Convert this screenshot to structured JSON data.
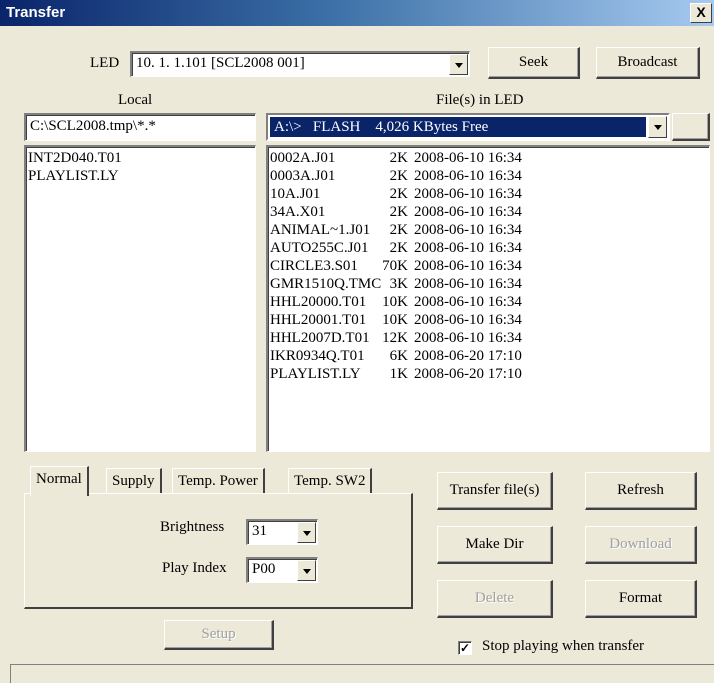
{
  "window": {
    "title": "Transfer",
    "close_glyph": "X"
  },
  "led": {
    "label": "LED",
    "selected": "10. 1. 1.101 [SCL2008 001]",
    "seek_label": "Seek",
    "broadcast_label": "Broadcast"
  },
  "local": {
    "header": "Local",
    "path": "C:\\SCL2008.tmp\\*.*",
    "files": [
      "INT2D040.T01",
      "PLAYLIST.LY"
    ]
  },
  "remote": {
    "header": "File(s) in LED",
    "drive": "A:\\>   FLASH    4,026 KBytes Free",
    "files": [
      {
        "name": "0002A.J01",
        "size": "2K",
        "date": "2008-06-10 16:34"
      },
      {
        "name": "0003A.J01",
        "size": "2K",
        "date": "2008-06-10 16:34"
      },
      {
        "name": "10A.J01",
        "size": "2K",
        "date": "2008-06-10 16:34"
      },
      {
        "name": "34A.X01",
        "size": "2K",
        "date": "2008-06-10 16:34"
      },
      {
        "name": "ANIMAL~1.J01",
        "size": "2K",
        "date": "2008-06-10 16:34"
      },
      {
        "name": "AUTO255C.J01",
        "size": "2K",
        "date": "2008-06-10 16:34"
      },
      {
        "name": "CIRCLE3.S01",
        "size": "70K",
        "date": "2008-06-10 16:34"
      },
      {
        "name": "GMR1510Q.TMC",
        "size": "3K",
        "date": "2008-06-10 16:34"
      },
      {
        "name": "HHL20000.T01",
        "size": "10K",
        "date": "2008-06-10 16:34"
      },
      {
        "name": "HHL20001.T01",
        "size": "10K",
        "date": "2008-06-10 16:34"
      },
      {
        "name": "HHL2007D.T01",
        "size": "12K",
        "date": "2008-06-10 16:34"
      },
      {
        "name": "IKR0934Q.T01",
        "size": "6K",
        "date": "2008-06-20 17:10"
      },
      {
        "name": "PLAYLIST.LY",
        "size": "1K",
        "date": "2008-06-20 17:10"
      }
    ]
  },
  "tabs": [
    {
      "label": "Normal"
    },
    {
      "label": "Supply"
    },
    {
      "label": "Temp. Power"
    },
    {
      "label": "Temp. SW2"
    }
  ],
  "normal": {
    "brightness_label": "Brightness",
    "brightness_value": "31",
    "play_index_label": "Play Index",
    "play_index_value": "P00",
    "setup_label": "Setup"
  },
  "actions": {
    "transfer_label": "Transfer file(s)",
    "refresh_label": "Refresh",
    "make_dir_label": "Make Dir",
    "download_label": "Download",
    "delete_label": "Delete",
    "format_label": "Format",
    "stop_playing_label": "Stop playing when transfer",
    "stop_playing_checked": "✓"
  },
  "colors": {
    "face": "#ece9d8",
    "selection": "#0a246a",
    "disabled_text": "#a0a0a0"
  }
}
